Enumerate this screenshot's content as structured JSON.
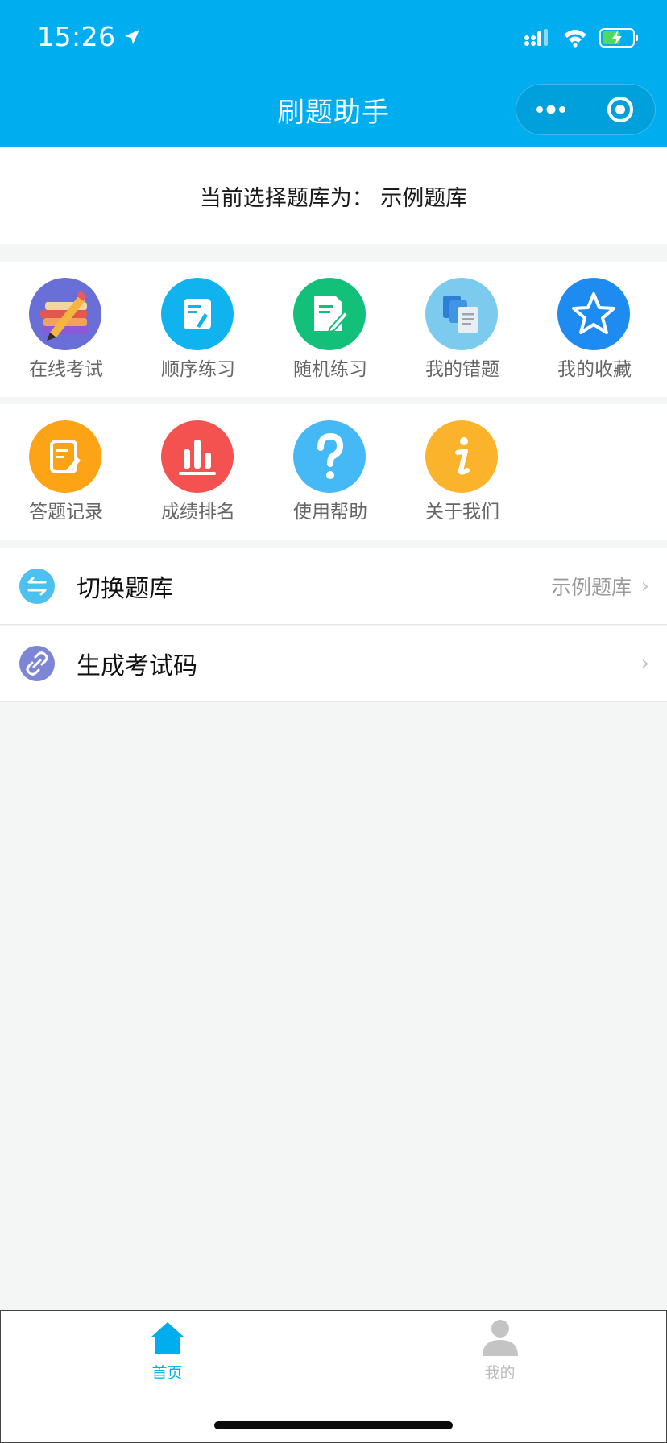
{
  "status": {
    "time": "15:26"
  },
  "header": {
    "title": "刷题助手"
  },
  "info": {
    "text": "当前选择题库为：  示例题库"
  },
  "grid": {
    "row1": [
      {
        "label": "在线考试",
        "icon": "books-pencil-icon",
        "color": "#6a6fd8"
      },
      {
        "label": "顺序练习",
        "icon": "note-pencil-icon",
        "color": "#10b3ee"
      },
      {
        "label": "随机练习",
        "icon": "document-edit-icon",
        "color": "#12c07a"
      },
      {
        "label": "我的错题",
        "icon": "documents-icon",
        "color": "#7ccaee"
      },
      {
        "label": "我的收藏",
        "icon": "star-icon",
        "color": "#1e8bf0"
      }
    ],
    "row2": [
      {
        "label": "答题记录",
        "icon": "record-edit-icon",
        "color": "#fca316"
      },
      {
        "label": "成绩排名",
        "icon": "bar-chart-icon",
        "color": "#f45250"
      },
      {
        "label": "使用帮助",
        "icon": "question-icon",
        "color": "#45b9f5"
      },
      {
        "label": "关于我们",
        "icon": "info-icon",
        "color": "#fcb32c"
      }
    ]
  },
  "rows": [
    {
      "label": "切换题库",
      "value": "示例题库",
      "icon": "switch-arrows-icon",
      "color": "#4cc1ef"
    },
    {
      "label": "生成考试码",
      "value": "",
      "icon": "link-icon",
      "color": "#7d86d4"
    }
  ],
  "tabs": [
    {
      "label": "首页",
      "icon": "home-icon",
      "active": true
    },
    {
      "label": "我的",
      "icon": "user-icon",
      "active": false
    }
  ],
  "colors": {
    "brand": "#00aeef",
    "background": "#f4f5f5"
  }
}
